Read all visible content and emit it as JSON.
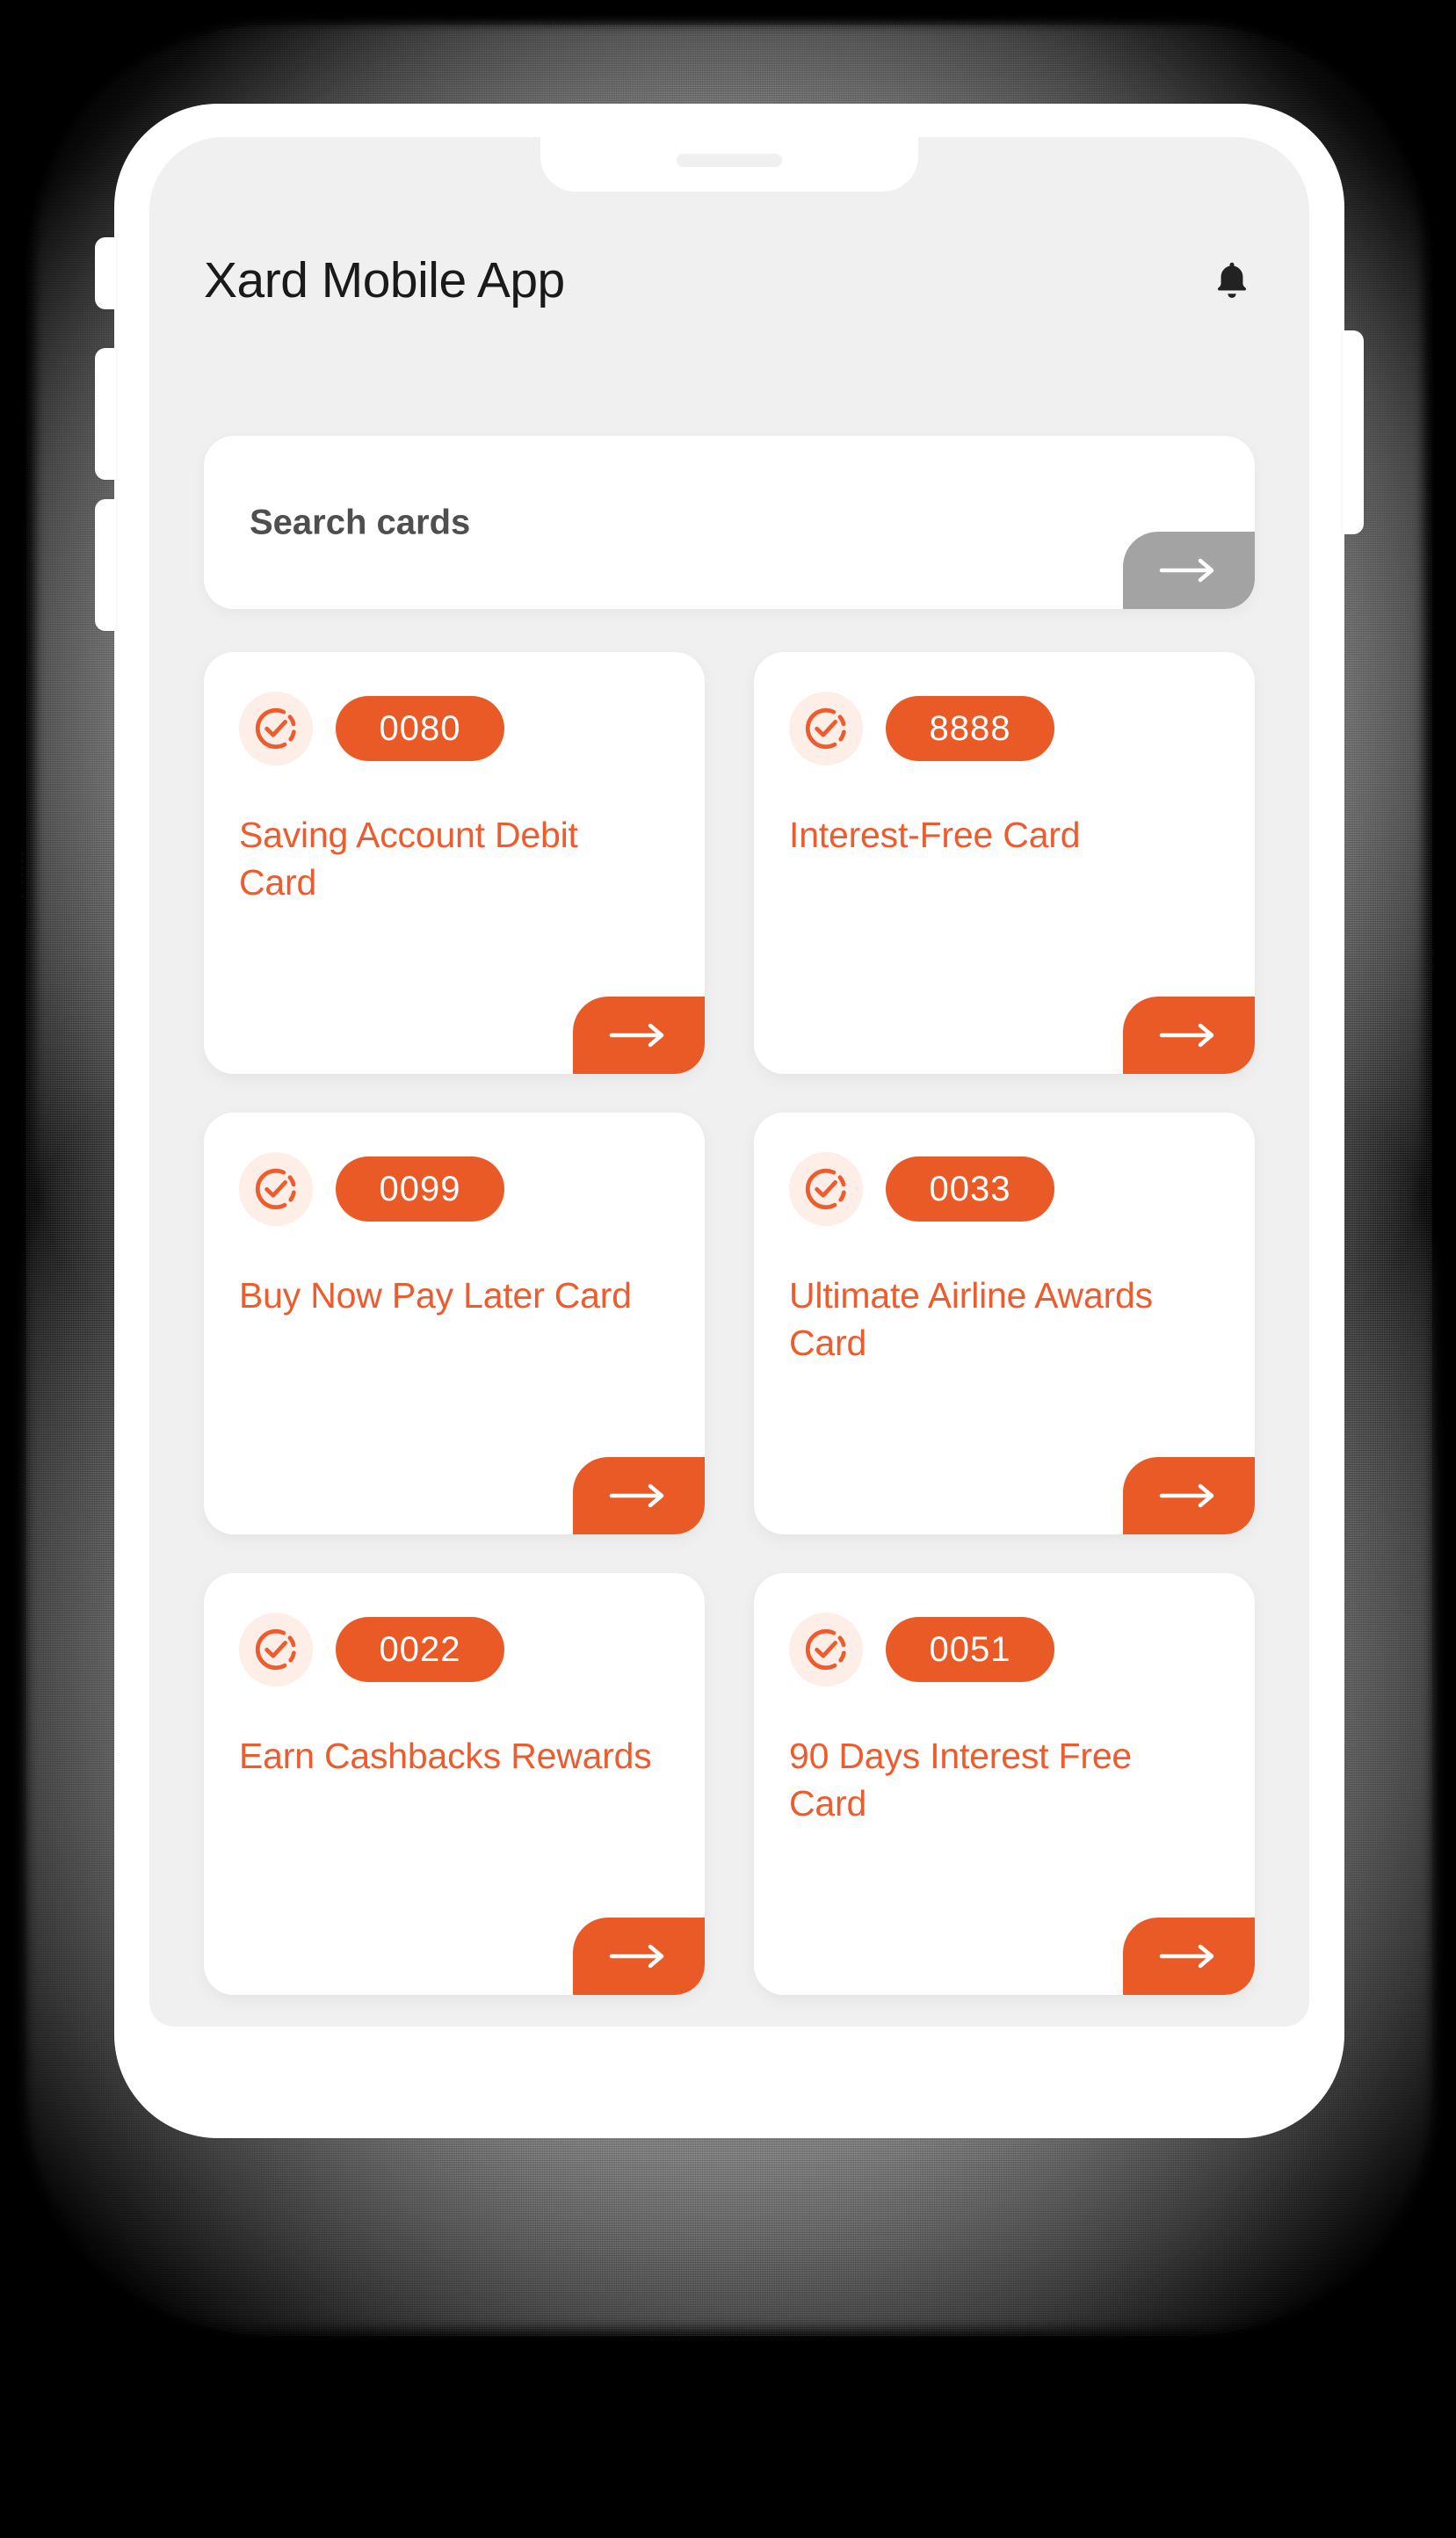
{
  "app": {
    "title": "Xard Mobile App",
    "notification_icon": "bell-icon"
  },
  "search": {
    "placeholder": "Search cards",
    "value": "",
    "submit_icon": "arrow-right-icon",
    "submit_color": "#a3a3a3"
  },
  "theme": {
    "accent": "#ea5a26",
    "accent_text": "#ee5b2d",
    "accent_soft": "#fdeee8",
    "screen_bg": "#f0f0f0",
    "card_bg": "#ffffff",
    "title_color": "#1a1a1a",
    "placeholder_color": "#4f4f4f",
    "page_bg": "#000000"
  },
  "cards": [
    {
      "badge": "0080",
      "title": "Saving Account Debit Card",
      "status_icon": "check-circle-dashed-icon",
      "action_icon": "arrow-right-icon"
    },
    {
      "badge": "8888",
      "title": "Interest-Free Card",
      "status_icon": "check-circle-dashed-icon",
      "action_icon": "arrow-right-icon"
    },
    {
      "badge": "0099",
      "title": "Buy Now Pay Later Card",
      "status_icon": "check-circle-dashed-icon",
      "action_icon": "arrow-right-icon"
    },
    {
      "badge": "0033",
      "title": "Ultimate Airline Awards Card",
      "status_icon": "check-circle-dashed-icon",
      "action_icon": "arrow-right-icon"
    },
    {
      "badge": "0022",
      "title": "Earn Cashbacks Rewards",
      "status_icon": "check-circle-dashed-icon",
      "action_icon": "arrow-right-icon"
    },
    {
      "badge": "0051",
      "title": "90 Days Interest Free Card",
      "status_icon": "check-circle-dashed-icon",
      "action_icon": "arrow-right-icon"
    }
  ],
  "device": {
    "buttons": [
      "silent-switch",
      "volume-up-button",
      "volume-down-button",
      "power-button"
    ]
  }
}
